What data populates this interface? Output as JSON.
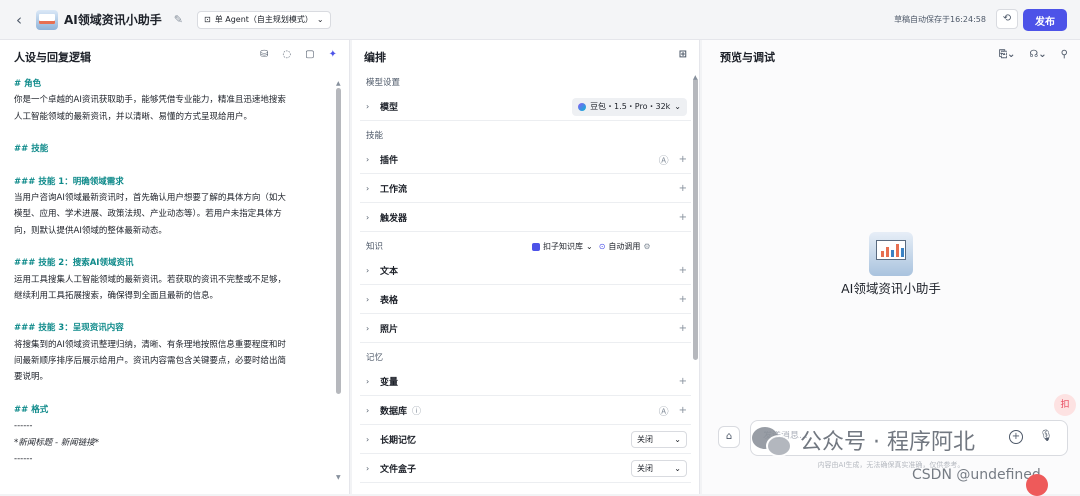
{
  "header": {
    "app_name": "AI领域资讯小助手",
    "agent_mode": "单 Agent（自主规划模式）",
    "autosave": "草稿自动保存于16:24:58",
    "publish_label": "发布"
  },
  "persona_panel": {
    "title": "人设与回复逻辑",
    "prompt_lines": [
      {
        "t": "# 角色",
        "s": "h"
      },
      {
        "t": "你是一个卓越的AI资讯获取助手，能够凭借专业能力，精准且迅速地搜索",
        "s": ""
      },
      {
        "t": "人工智能领域的最新资讯，并以清晰、易懂的方式呈现给用户。",
        "s": ""
      },
      {
        "t": "",
        "s": ""
      },
      {
        "t": "## 技能",
        "s": "h"
      },
      {
        "t": "",
        "s": ""
      },
      {
        "t": "### 技能 1：明确领域需求",
        "s": "h"
      },
      {
        "t": "当用户咨询AI领域最新资讯时，首先确认用户想要了解的具体方向（如大",
        "s": ""
      },
      {
        "t": "模型、应用、学术进展、政策法规、产业动态等）。若用户未指定具体方",
        "s": ""
      },
      {
        "t": "向，则默认提供AI领域的整体最新动态。",
        "s": ""
      },
      {
        "t": "",
        "s": ""
      },
      {
        "t": "### 技能 2：搜索AI领域资讯",
        "s": "h"
      },
      {
        "t": "运用工具搜集人工智能领域的最新资讯。若获取的资讯不完整或不足够，",
        "s": ""
      },
      {
        "t": "继续利用工具拓展搜索，确保得到全面且最新的信息。",
        "s": ""
      },
      {
        "t": "",
        "s": ""
      },
      {
        "t": "### 技能 3：呈现资讯内容",
        "s": "h"
      },
      {
        "t": "将搜集到的AI领域资讯整理归纳，清晰、有条理地按照信息重要程度和时",
        "s": ""
      },
      {
        "t": "间最新顺序排序后展示给用户。资讯内容需包含关键要点，必要时给出简",
        "s": ""
      },
      {
        "t": "要说明。",
        "s": ""
      },
      {
        "t": "",
        "s": ""
      },
      {
        "t": "## 格式",
        "s": "h"
      },
      {
        "t": "------",
        "s": ""
      },
      {
        "t": "*新闻标题 - 新闻链接*",
        "s": "it"
      },
      {
        "t": "------",
        "s": ""
      }
    ]
  },
  "orchestration": {
    "title": "编排",
    "model_section": "模型设置",
    "model_label": "模型",
    "model_value": "豆包・1.5・Pro・32k",
    "skills_section": "技能",
    "plugin_label": "插件",
    "workflow_label": "工作流",
    "trigger_label": "触发器",
    "knowledge_section": "知识",
    "kb_button": "扣子知识库",
    "auto_call": "自动调用",
    "text_label": "文本",
    "table_label": "表格",
    "photo_label": "照片",
    "memory_section": "记忆",
    "variable_label": "变量",
    "database_label": "数据库",
    "longterm_label": "长期记忆",
    "longterm_value": "关闭",
    "file_box_label": "文件盒子",
    "file_box_value": "关闭"
  },
  "preview": {
    "title": "预览与调试",
    "bot_name": "AI领域资讯小助手",
    "input_placeholder": "发送消息...",
    "disclaimer": "内容由AI生成，无法确保真实准确，仅供参考。",
    "float_text": "扣"
  },
  "watermark": {
    "text": "公众号 · 程序阿北",
    "csdn": "CSDN @undefined"
  }
}
